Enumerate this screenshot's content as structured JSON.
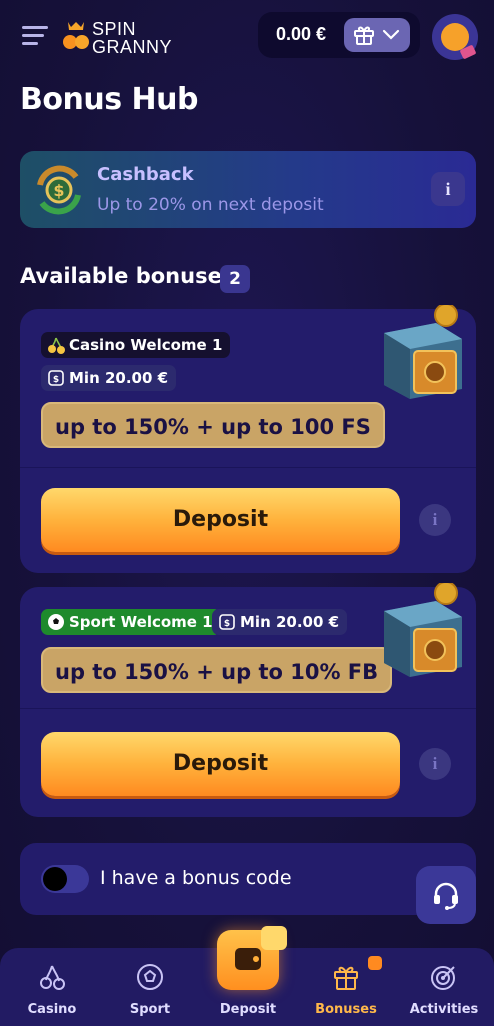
{
  "header": {
    "logo_line1": "SPIN",
    "logo_line2": "GRANNY",
    "balance": "0.00 €"
  },
  "page_title": "Bonus Hub",
  "cashback": {
    "title": "Cashback",
    "subtitle": "Up to 20% on next deposit",
    "info_label": "i"
  },
  "available": {
    "label": "Available bonuses",
    "count": "2"
  },
  "bonuses": [
    {
      "name": "Casino Welcome 1",
      "min": "Min 20.00 €",
      "offer": "up to 150% + up to 100 FS",
      "deposit_label": "Deposit",
      "info_label": "i"
    },
    {
      "name": "Sport Welcome 1",
      "min": "Min 20.00 €",
      "offer": "up to 150% + up to 10% FB",
      "deposit_label": "Deposit",
      "info_label": "i"
    }
  ],
  "bonus_code": {
    "label": "I have a bonus code",
    "enabled": false
  },
  "nav": {
    "casino": "Casino",
    "sport": "Sport",
    "deposit": "Deposit",
    "bonuses": "Bonuses",
    "activities": "Activities",
    "active": "bonuses"
  },
  "colors": {
    "background": "#17123d",
    "card": "#231c6b",
    "accent_orange": "#ff8a20",
    "offer_gold": "#c9a466",
    "sport_green": "#1e8a2c"
  },
  "icons": [
    "menu-icon",
    "logo-crown-icon",
    "gift-icon",
    "chevron-down-icon",
    "avatar-pumpkin-icon",
    "cashback-coin-icon",
    "cherry-icon",
    "coupon-icon",
    "football-icon",
    "safe-icon",
    "info-icon",
    "headset-icon",
    "wallet-icon",
    "target-icon"
  ]
}
